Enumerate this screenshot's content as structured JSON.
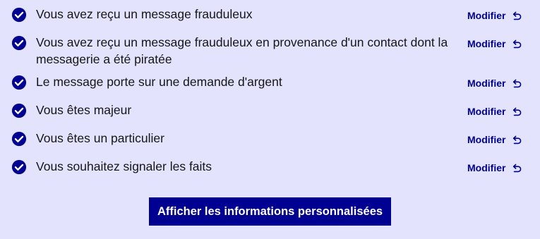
{
  "summary": {
    "items": [
      {
        "text": "Vous avez reçu un message frauduleux",
        "action": "Modifier"
      },
      {
        "text": "Vous avez reçu un message frauduleux en provenance d'un contact dont la messagerie a été piratée",
        "action": "Modifier"
      },
      {
        "text": "Le message porte sur une demande d'argent",
        "action": "Modifier"
      },
      {
        "text": "Vous êtes majeur",
        "action": "Modifier"
      },
      {
        "text": "Vous êtes un particulier",
        "action": "Modifier"
      },
      {
        "text": "Vous souhaitez signaler les faits",
        "action": "Modifier"
      }
    ]
  },
  "cta": {
    "label": "Afficher les informations personnalisées"
  },
  "icons": {
    "item_status": "check-circle-icon",
    "modify": "undo-arrow-icon"
  },
  "colors": {
    "background": "#e3e3fd",
    "primary": "#000091",
    "text": "#161616",
    "button_text": "#ffffff"
  }
}
